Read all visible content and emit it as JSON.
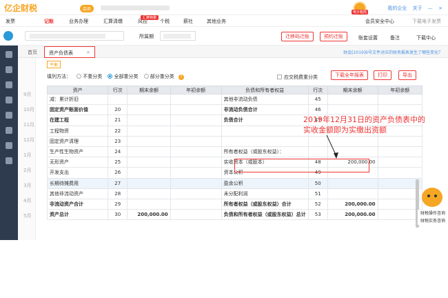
{
  "app": {
    "logo": "亿企财税",
    "vip": "会员",
    "avatar_tag": "电子税局"
  },
  "top_links": [
    "我的企业",
    "关于",
    "—",
    "×"
  ],
  "menu": {
    "items": [
      "发票",
      "记账",
      "业务办理",
      "汇算清缴",
      "风控",
      "个税",
      "薪社",
      "其他业务"
    ],
    "active_index": 1,
    "hot_tag": "汇算特惠",
    "safety": "会员安全中心",
    "download_client": "下载电子发票"
  },
  "toolbar": {
    "period_label": "所属期",
    "btn_transfer": "迁移码迁账",
    "btn_booking": "预约迁账",
    "account_settings": "账套设置",
    "remark": "备注",
    "download_center": "下载中心"
  },
  "months": [
    "9月",
    "10月",
    "11月",
    "12月",
    "1月",
    "2月",
    "3月",
    "4月",
    "5月"
  ],
  "tabs": {
    "home": "首页",
    "active": "资产负债表",
    "close": "×"
  },
  "notice": "财会[2019]6号文件对应的财务报表发生了哪些变化？",
  "form": {
    "print_tag": "平衡",
    "fill_label": "填列方法：",
    "options": [
      "不重分类",
      "全部重分类",
      "部分重分类"
    ],
    "selected": 1,
    "checkbox_label": "应交税费重分类",
    "btn_download": "下载全年报表",
    "btn_print": "打印",
    "btn_export": "导出"
  },
  "table": {
    "headers": [
      "资产",
      "行次",
      "期末余额",
      "年初余额",
      "负债和所有者权益",
      "行次",
      "期末余额",
      "年初余额"
    ],
    "rows": [
      [
        "减：累计折旧",
        "",
        "",
        "",
        "其他非流动负债",
        "45",
        "",
        ""
      ],
      [
        "固定资产账面价值",
        "20",
        "",
        "",
        "非流动负债合计",
        "46",
        "",
        ""
      ],
      [
        "在建工程",
        "21",
        "",
        "",
        "负债合计",
        "47",
        "",
        ""
      ],
      [
        "工程物资",
        "22",
        "",
        "",
        "",
        "",
        "",
        ""
      ],
      [
        "固定资产清理",
        "23",
        "",
        "",
        "",
        "",
        "",
        ""
      ],
      [
        "生产性生物资产",
        "24",
        "",
        "",
        "所有者权益（或股东权益）：",
        "",
        "",
        ""
      ],
      [
        "无形资产",
        "25",
        "",
        "",
        "实收资本（或股本）",
        "48",
        "200,000.00",
        ""
      ],
      [
        "开发支出",
        "26",
        "",
        "",
        "资本公积",
        "49",
        "",
        ""
      ],
      [
        "长期待摊费用",
        "27",
        "",
        "",
        "盈余公积",
        "50",
        "",
        ""
      ],
      [
        "其他非流动资产",
        "28",
        "",
        "",
        "未分配利润",
        "51",
        "",
        ""
      ],
      [
        "非流动资产合计",
        "29",
        "",
        "",
        "所有者权益（或股东权益）合计",
        "52",
        "200,000.00",
        ""
      ],
      [
        "资产总计",
        "30",
        "200,000.00",
        "",
        "负债和所有者权益（或股东权益）总计",
        "53",
        "200,000.00",
        ""
      ]
    ],
    "bold_rows": [
      1,
      2,
      10,
      11
    ],
    "highlight_row": 8
  },
  "annotation": "2019年12月31日的资产负债表中的实收金额即为实缴出资额",
  "help_panel": [
    "财税操作咨询",
    "财税实务咨询"
  ]
}
